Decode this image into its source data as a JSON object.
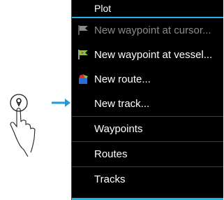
{
  "menu": {
    "title": "Plot",
    "items": [
      {
        "label": "New waypoint at cursor...",
        "icon": "waypoint-flag-icon",
        "disabled": true
      },
      {
        "label": "New waypoint at vessel...",
        "icon": "waypoint-flag-icon",
        "disabled": false
      },
      {
        "label": "New route...",
        "icon": "route-icon",
        "disabled": false
      },
      {
        "label": "New track...",
        "icon": "",
        "disabled": false
      },
      {
        "label": "Waypoints",
        "icon": "",
        "disabled": false
      },
      {
        "label": "Routes",
        "icon": "",
        "disabled": false
      },
      {
        "label": "Tracks",
        "icon": "",
        "disabled": false
      }
    ]
  },
  "colors": {
    "accent": "#22b3e6",
    "menu_bg": "#000000",
    "disabled_text": "#8b8b8b",
    "arrow": "#1f9bd7",
    "flag_green": "#86c440"
  },
  "gesture": {
    "icon": "tap-finger-icon",
    "arrow": "right-arrow-icon",
    "pin": "location-pin-icon"
  }
}
